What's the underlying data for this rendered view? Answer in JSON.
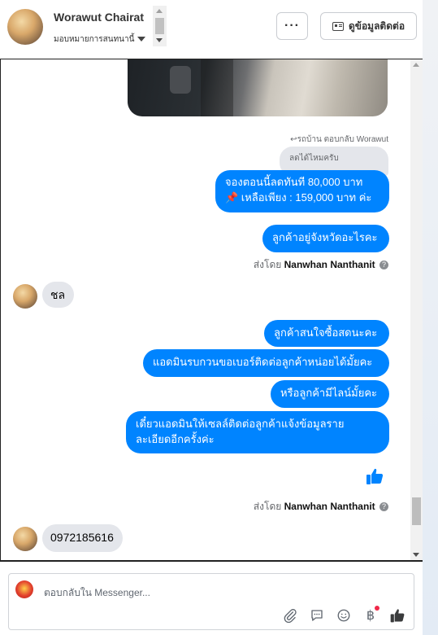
{
  "header": {
    "name": "Worawut Chairat",
    "subtitle": "มอบหมายการสนทนานี้",
    "more_label": "···",
    "contact_label": "ดูข้อมูลติดต่อ"
  },
  "messages": {
    "reply_meta": "รถบ้าน ตอบกลับ Worawut",
    "quote": "ลดได้ไหมครับ",
    "m1_line1": "จองตอนนี้ลดทันที 80,000 บาท",
    "m1_line2": "📌 เหลือเพียง : 159,000 บาท ค่ะ",
    "m2": "ลูกค้าอยู่จังหวัดอะไรคะ",
    "sent_by_prefix": "ส่งโดย",
    "sent_by_name": "Nanwhan Nanthanit",
    "in1": "ชล",
    "m3": "ลูกค้าสนใจซื้อสดนะคะ",
    "m4": "แอดมินรบกวนขอเบอร์ติดต่อลูกค้าหน่อยได้มั้ยคะ",
    "m5": "หรือลูกค้ามีไลน์มั้ยคะ",
    "m6_line1": "เดี๋ยวแอดมินให้เซลล์ติดต่อลูกค้าแจ้งข้อมูลราย",
    "m6_line2": "ละเอียดอีกครั้งค่ะ",
    "in2": "0972185616"
  },
  "composer": {
    "placeholder": "ตอบกลับใน Messenger..."
  },
  "colors": {
    "outgoing_bubble": "#0084ff",
    "incoming_bubble": "#e4e6eb"
  },
  "icons": {
    "attach": "paperclip-icon",
    "saved_replies": "chat-bubble-icon",
    "emoji": "emoji-icon",
    "payment": "baht-icon",
    "like": "thumbs-up-icon"
  }
}
